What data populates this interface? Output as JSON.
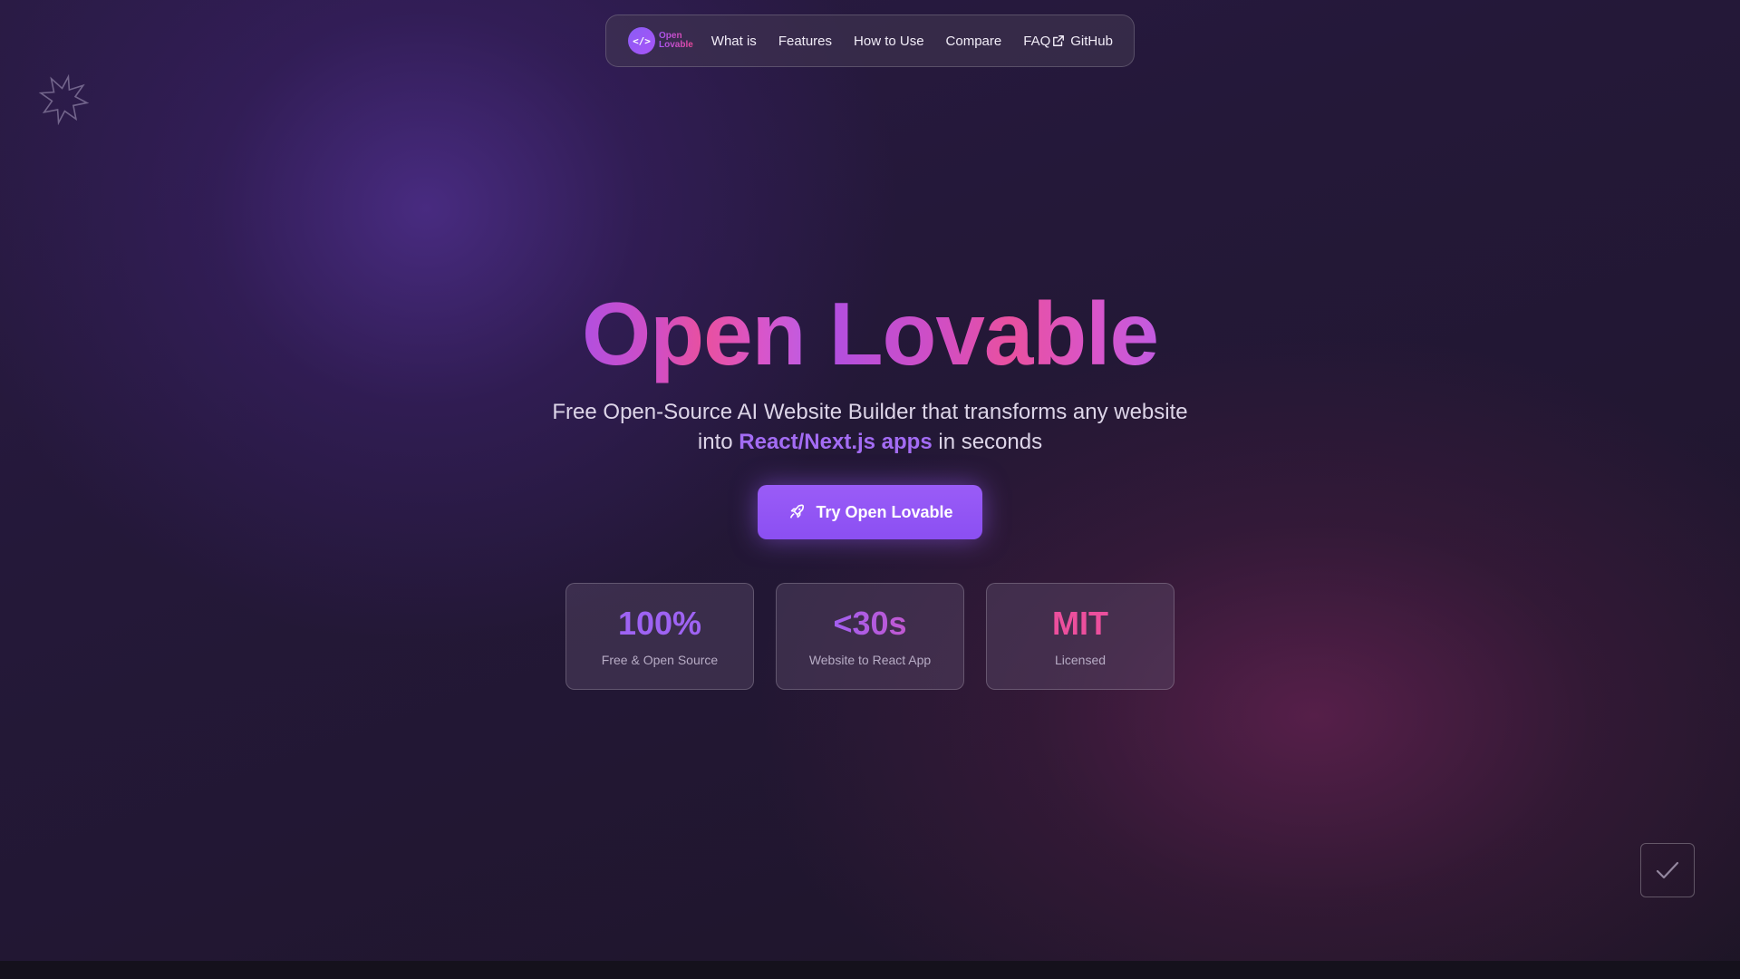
{
  "nav": {
    "logo": {
      "line1": "Open",
      "line2": "Lovable",
      "glyph": "</>"
    },
    "links": [
      "What is",
      "Features",
      "How to Use",
      "Compare",
      "FAQ"
    ],
    "github_label": "GitHub"
  },
  "hero": {
    "title_word1": "Open",
    "title_word2": "Lovable",
    "subtitle_line1": "Free Open-Source AI Website Builder that transforms any website",
    "subtitle_into": "into",
    "subtitle_highlight": "React/Next.js apps",
    "subtitle_end": "in seconds",
    "cta_label": "Try Open Lovable"
  },
  "stats": [
    {
      "value": "100%",
      "label": "Free & Open Source",
      "color": "#9e63f3"
    },
    {
      "value": "<30s",
      "label": "Website to React App",
      "color": "#b05ee0"
    },
    {
      "value": "MIT",
      "label": "Licensed",
      "color": "#ec4f9d"
    }
  ],
  "icons": {
    "logo": "code-brackets-icon",
    "external": "external-link-icon",
    "cta": "rocket-icon",
    "decor": "star-burst-icon",
    "corner": "checkmark-icon"
  },
  "colors": {
    "accent_purple": "#8b5cf6",
    "accent_pink": "#ec4899",
    "background": "#241839"
  }
}
